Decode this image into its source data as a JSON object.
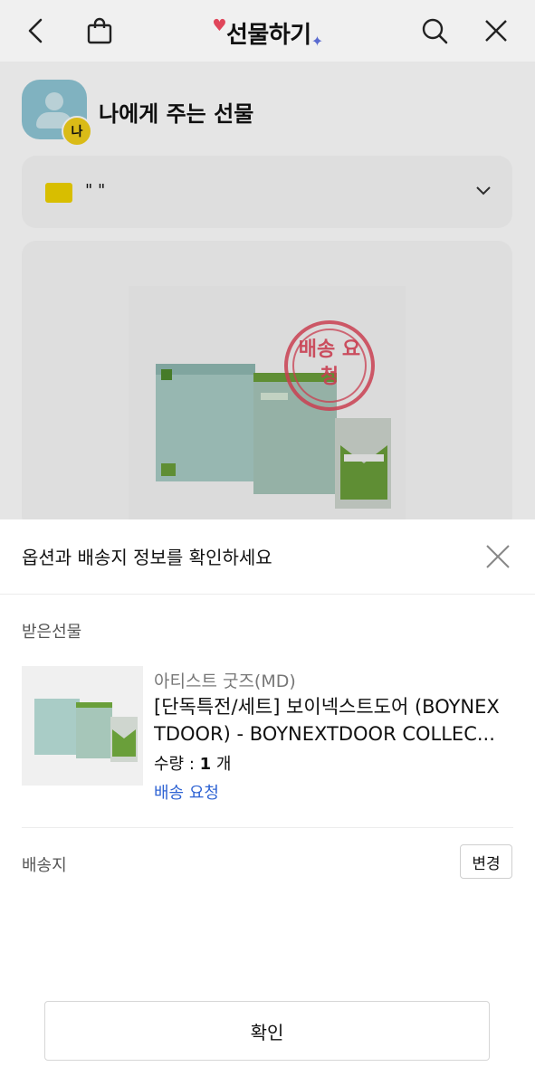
{
  "header": {
    "title": "선물하기",
    "back_icon": "back-chevron-icon",
    "bag_icon": "shopping-bag-icon",
    "search_icon": "search-icon",
    "close_icon": "close-icon"
  },
  "recipient": {
    "name": "나에게 주는 선물",
    "badge": "나"
  },
  "message_card": {
    "text": "\" \""
  },
  "product_card": {
    "stamp_text": "배송 요청"
  },
  "sheet": {
    "title": "옵션과 배송지 정보를 확인하세요",
    "received_label": "받은선물",
    "product": {
      "category": "아티스트 굿즈(MD)",
      "title_line1": "[단독특전/세트] 보이넥스트도어 (BOYNEX",
      "title_line2": "TDOOR) - BOYNEXTDOOR COLLEC...",
      "qty_label": "수량 : ",
      "qty_value": "1",
      "qty_unit": " 개",
      "status": "배송 요청"
    },
    "address_label": "배송지",
    "change_button": "변경",
    "confirm_button": "확인"
  },
  "colors": {
    "accent_blue": "#2e63d3",
    "badge_yellow": "#f3d11a",
    "stamp_red": "#e0465a"
  }
}
